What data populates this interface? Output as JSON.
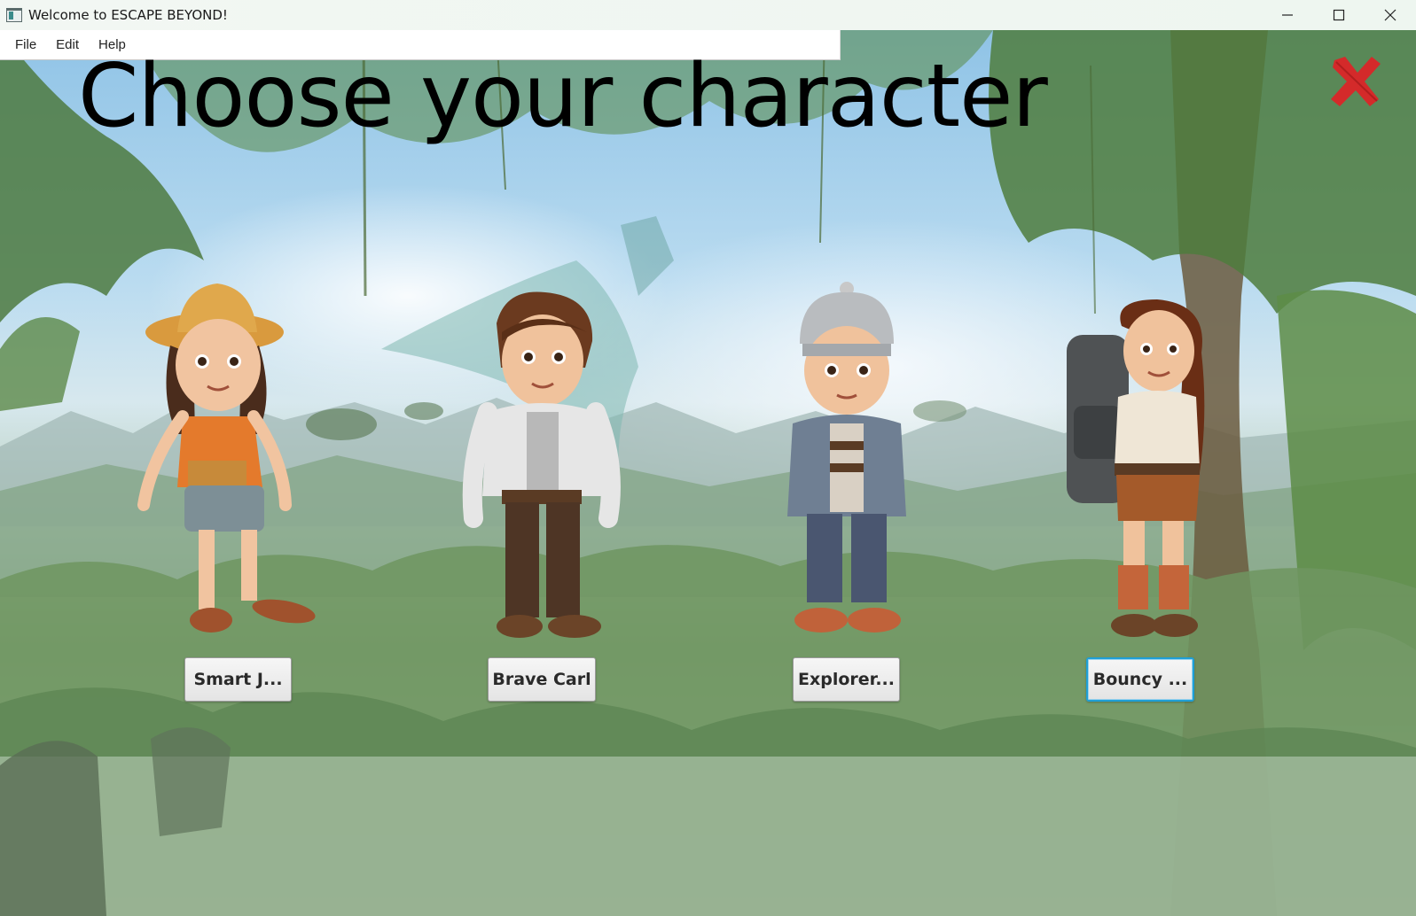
{
  "window": {
    "title": "Welcome to ESCAPE BEYOND!",
    "controls": [
      "minimize",
      "maximize",
      "close"
    ]
  },
  "menubar": {
    "items": [
      {
        "label": "File"
      },
      {
        "label": "Edit"
      },
      {
        "label": "Help"
      }
    ]
  },
  "main": {
    "heading": "Choose your character",
    "close_icon": "red-x-icon",
    "characters": [
      {
        "button_label": "Smart J...",
        "focused": false,
        "icon": "explorer-girl-hat-icon"
      },
      {
        "button_label": "Brave Carl",
        "focused": false,
        "icon": "boy-hoodie-icon"
      },
      {
        "button_label": "Explorer...",
        "focused": false,
        "icon": "boy-beanie-icon"
      },
      {
        "button_label": "Bouncy ...",
        "focused": true,
        "icon": "girl-backpack-icon"
      }
    ]
  },
  "colors": {
    "close_x": "#d42a2a",
    "focus_border": "#1f9fd6",
    "heading": "#000000"
  }
}
